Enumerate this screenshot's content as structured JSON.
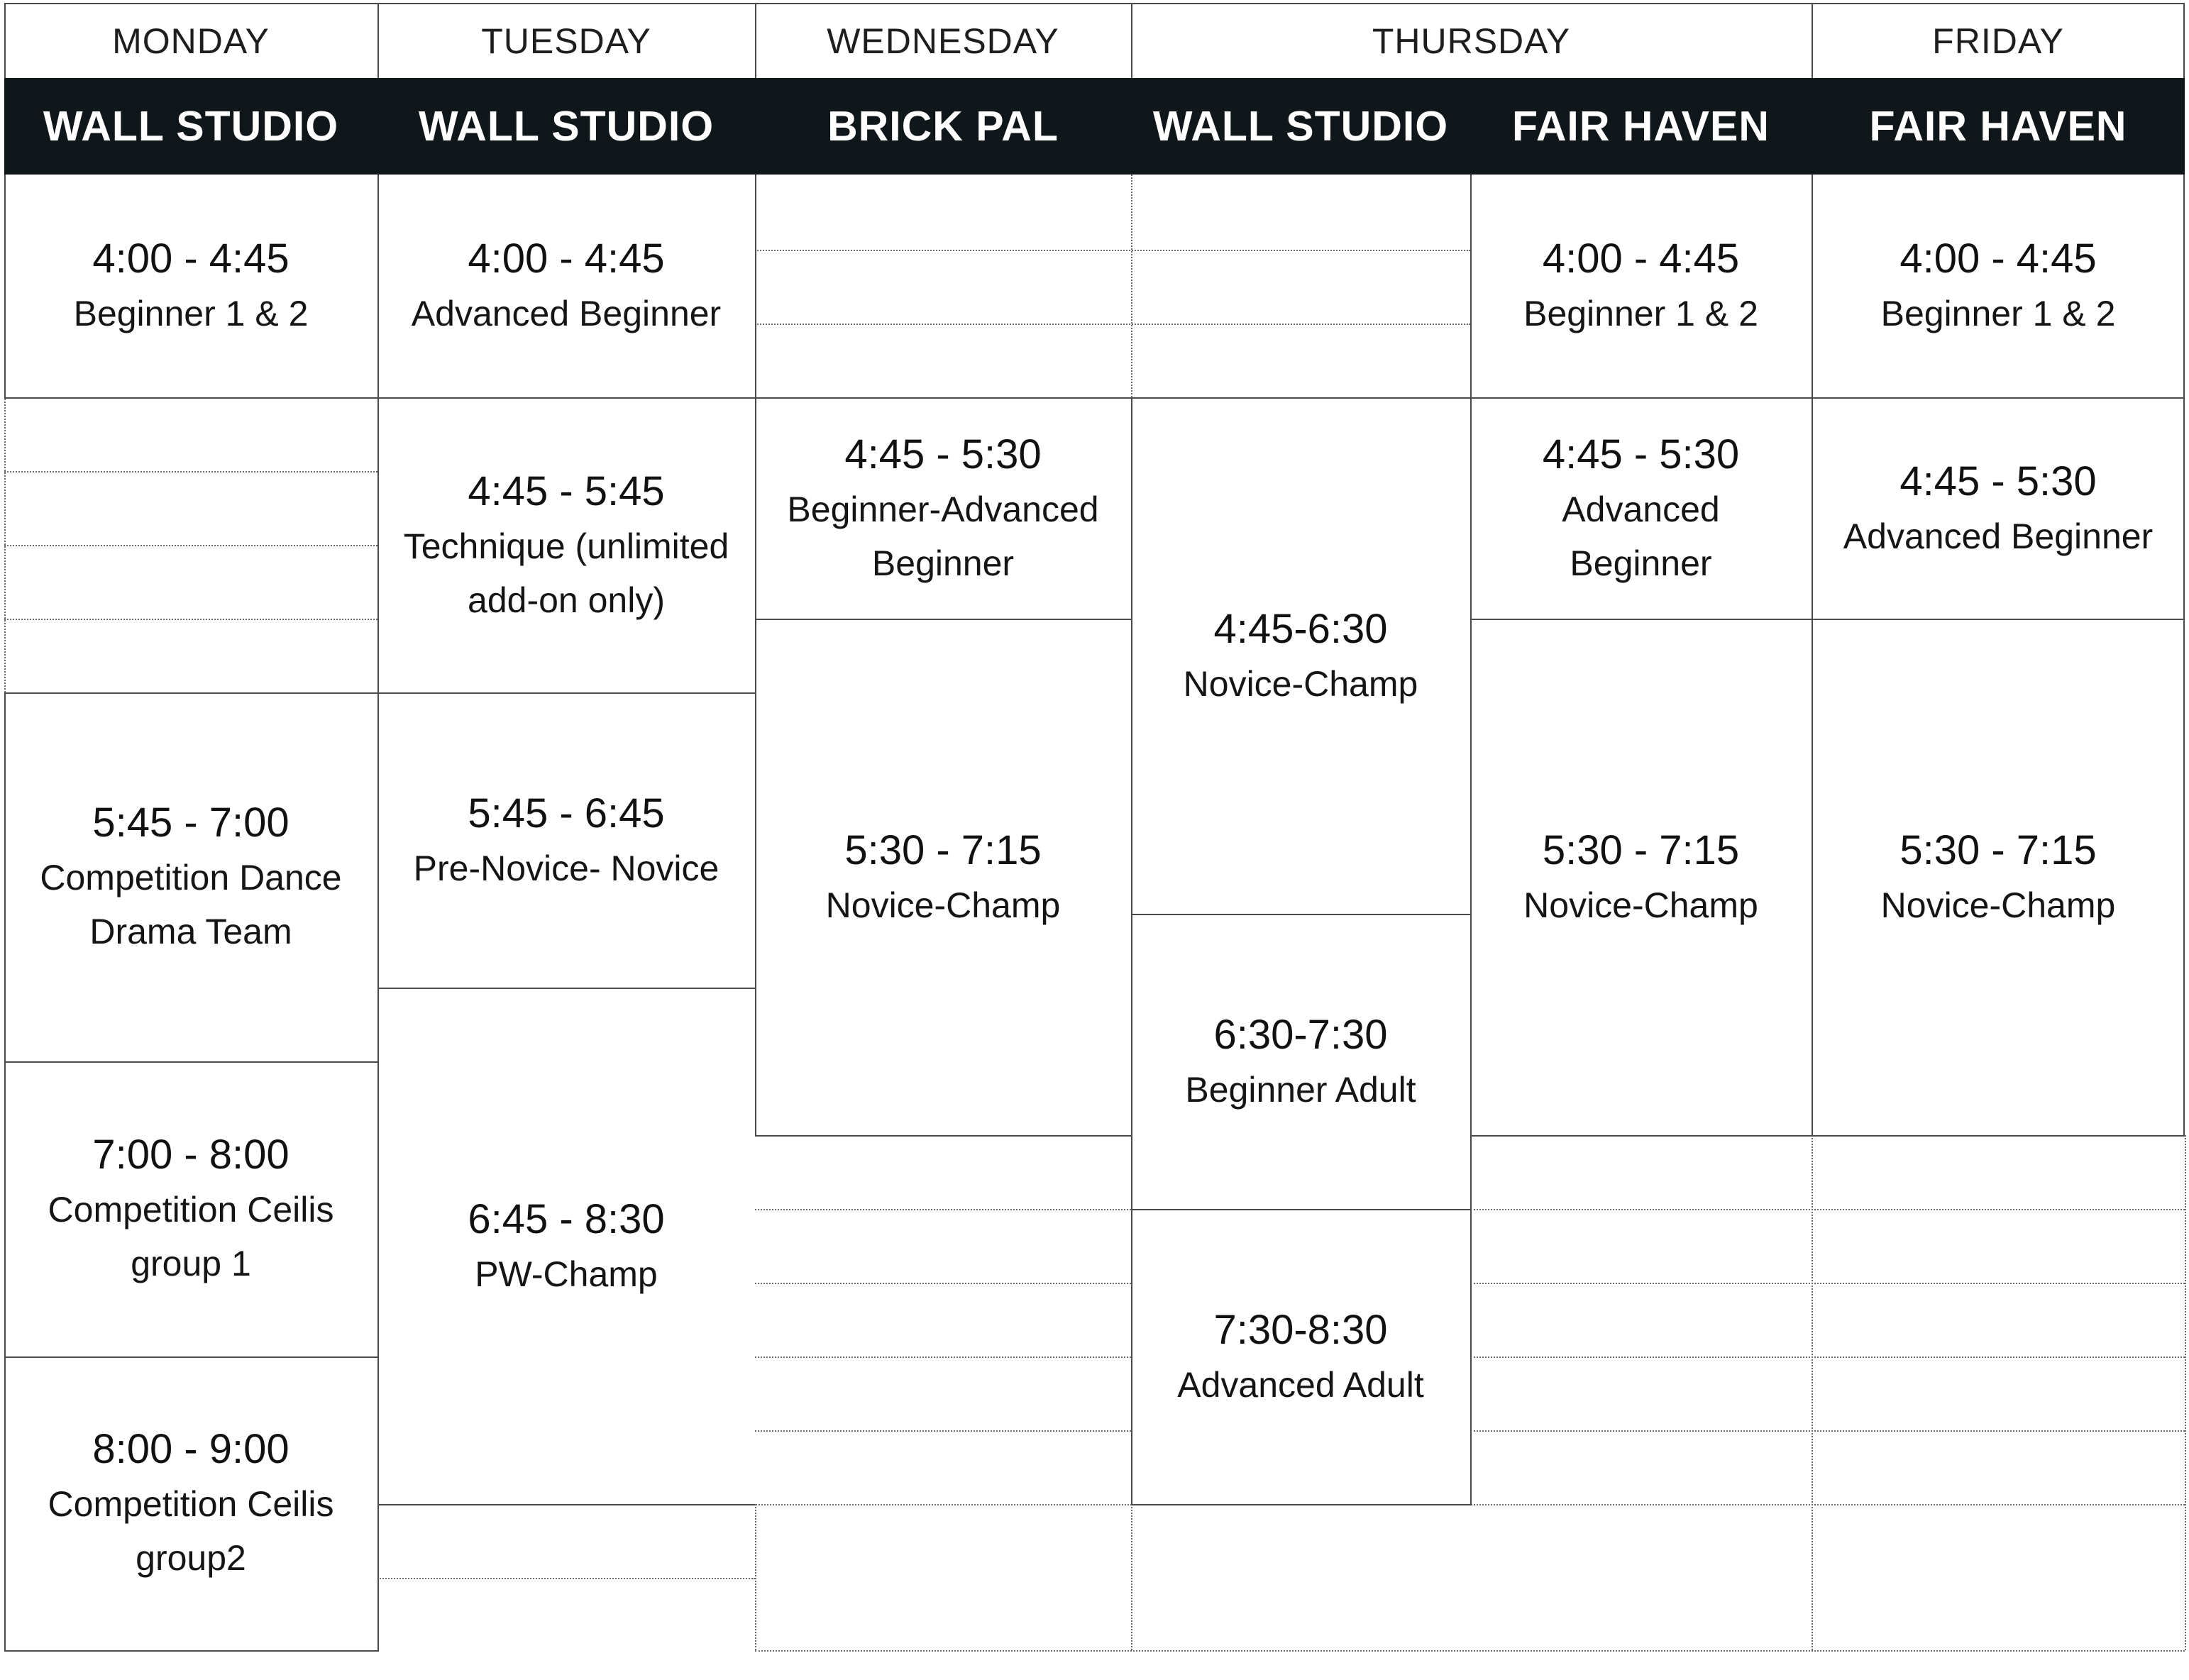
{
  "days": [
    "MONDAY",
    "TUESDAY",
    "WEDNESDAY",
    "THURSDAY",
    "FRIDAY"
  ],
  "studios": [
    "WALL STUDIO",
    "WALL STUDIO",
    "BRICK PAL",
    "WALL STUDIO",
    "FAIR HAVEN",
    "FAIR HAVEN"
  ],
  "classes": [
    {
      "time": "4:00 - 4:45",
      "name": "Beginner 1 & 2"
    },
    {
      "time": "5:45 - 7:00",
      "name": "Competition Dance Drama Team"
    },
    {
      "time": "7:00 - 8:00",
      "name": "Competition Ceilis group 1"
    },
    {
      "time": "8:00 - 9:00",
      "name": "Competition Ceilis group2"
    },
    {
      "time": "4:00 - 4:45",
      "name": "Advanced Beginner"
    },
    {
      "time": "4:45 - 5:45",
      "name": "Technique (unlimited add-on only)"
    },
    {
      "time": "5:45 - 6:45",
      "name": "Pre-Novice- Novice"
    },
    {
      "time": "6:45 - 8:30",
      "name": "PW-Champ"
    },
    {
      "time": "4:45 - 5:30",
      "name": "Beginner-Advanced Beginner"
    },
    {
      "time": "5:30 - 7:15",
      "name": "Novice-Champ"
    },
    {
      "time": "4:45-6:30",
      "name": "Novice-Champ"
    },
    {
      "time": "6:30-7:30",
      "name": "Beginner Adult"
    },
    {
      "time": "7:30-8:30",
      "name": "Advanced Adult"
    },
    {
      "time": "4:00 - 4:45",
      "name": "Beginner 1 & 2"
    },
    {
      "time": "4:45 - 5:30",
      "name": "Advanced Beginner"
    },
    {
      "time": "5:30 - 7:15",
      "name": "Novice-Champ"
    },
    {
      "time": "4:00 - 4:45",
      "name": "Beginner 1 & 2"
    },
    {
      "time": "4:45 - 5:30",
      "name": "Advanced Beginner"
    },
    {
      "time": "5:30 - 7:15",
      "name": "Novice-Champ"
    }
  ]
}
